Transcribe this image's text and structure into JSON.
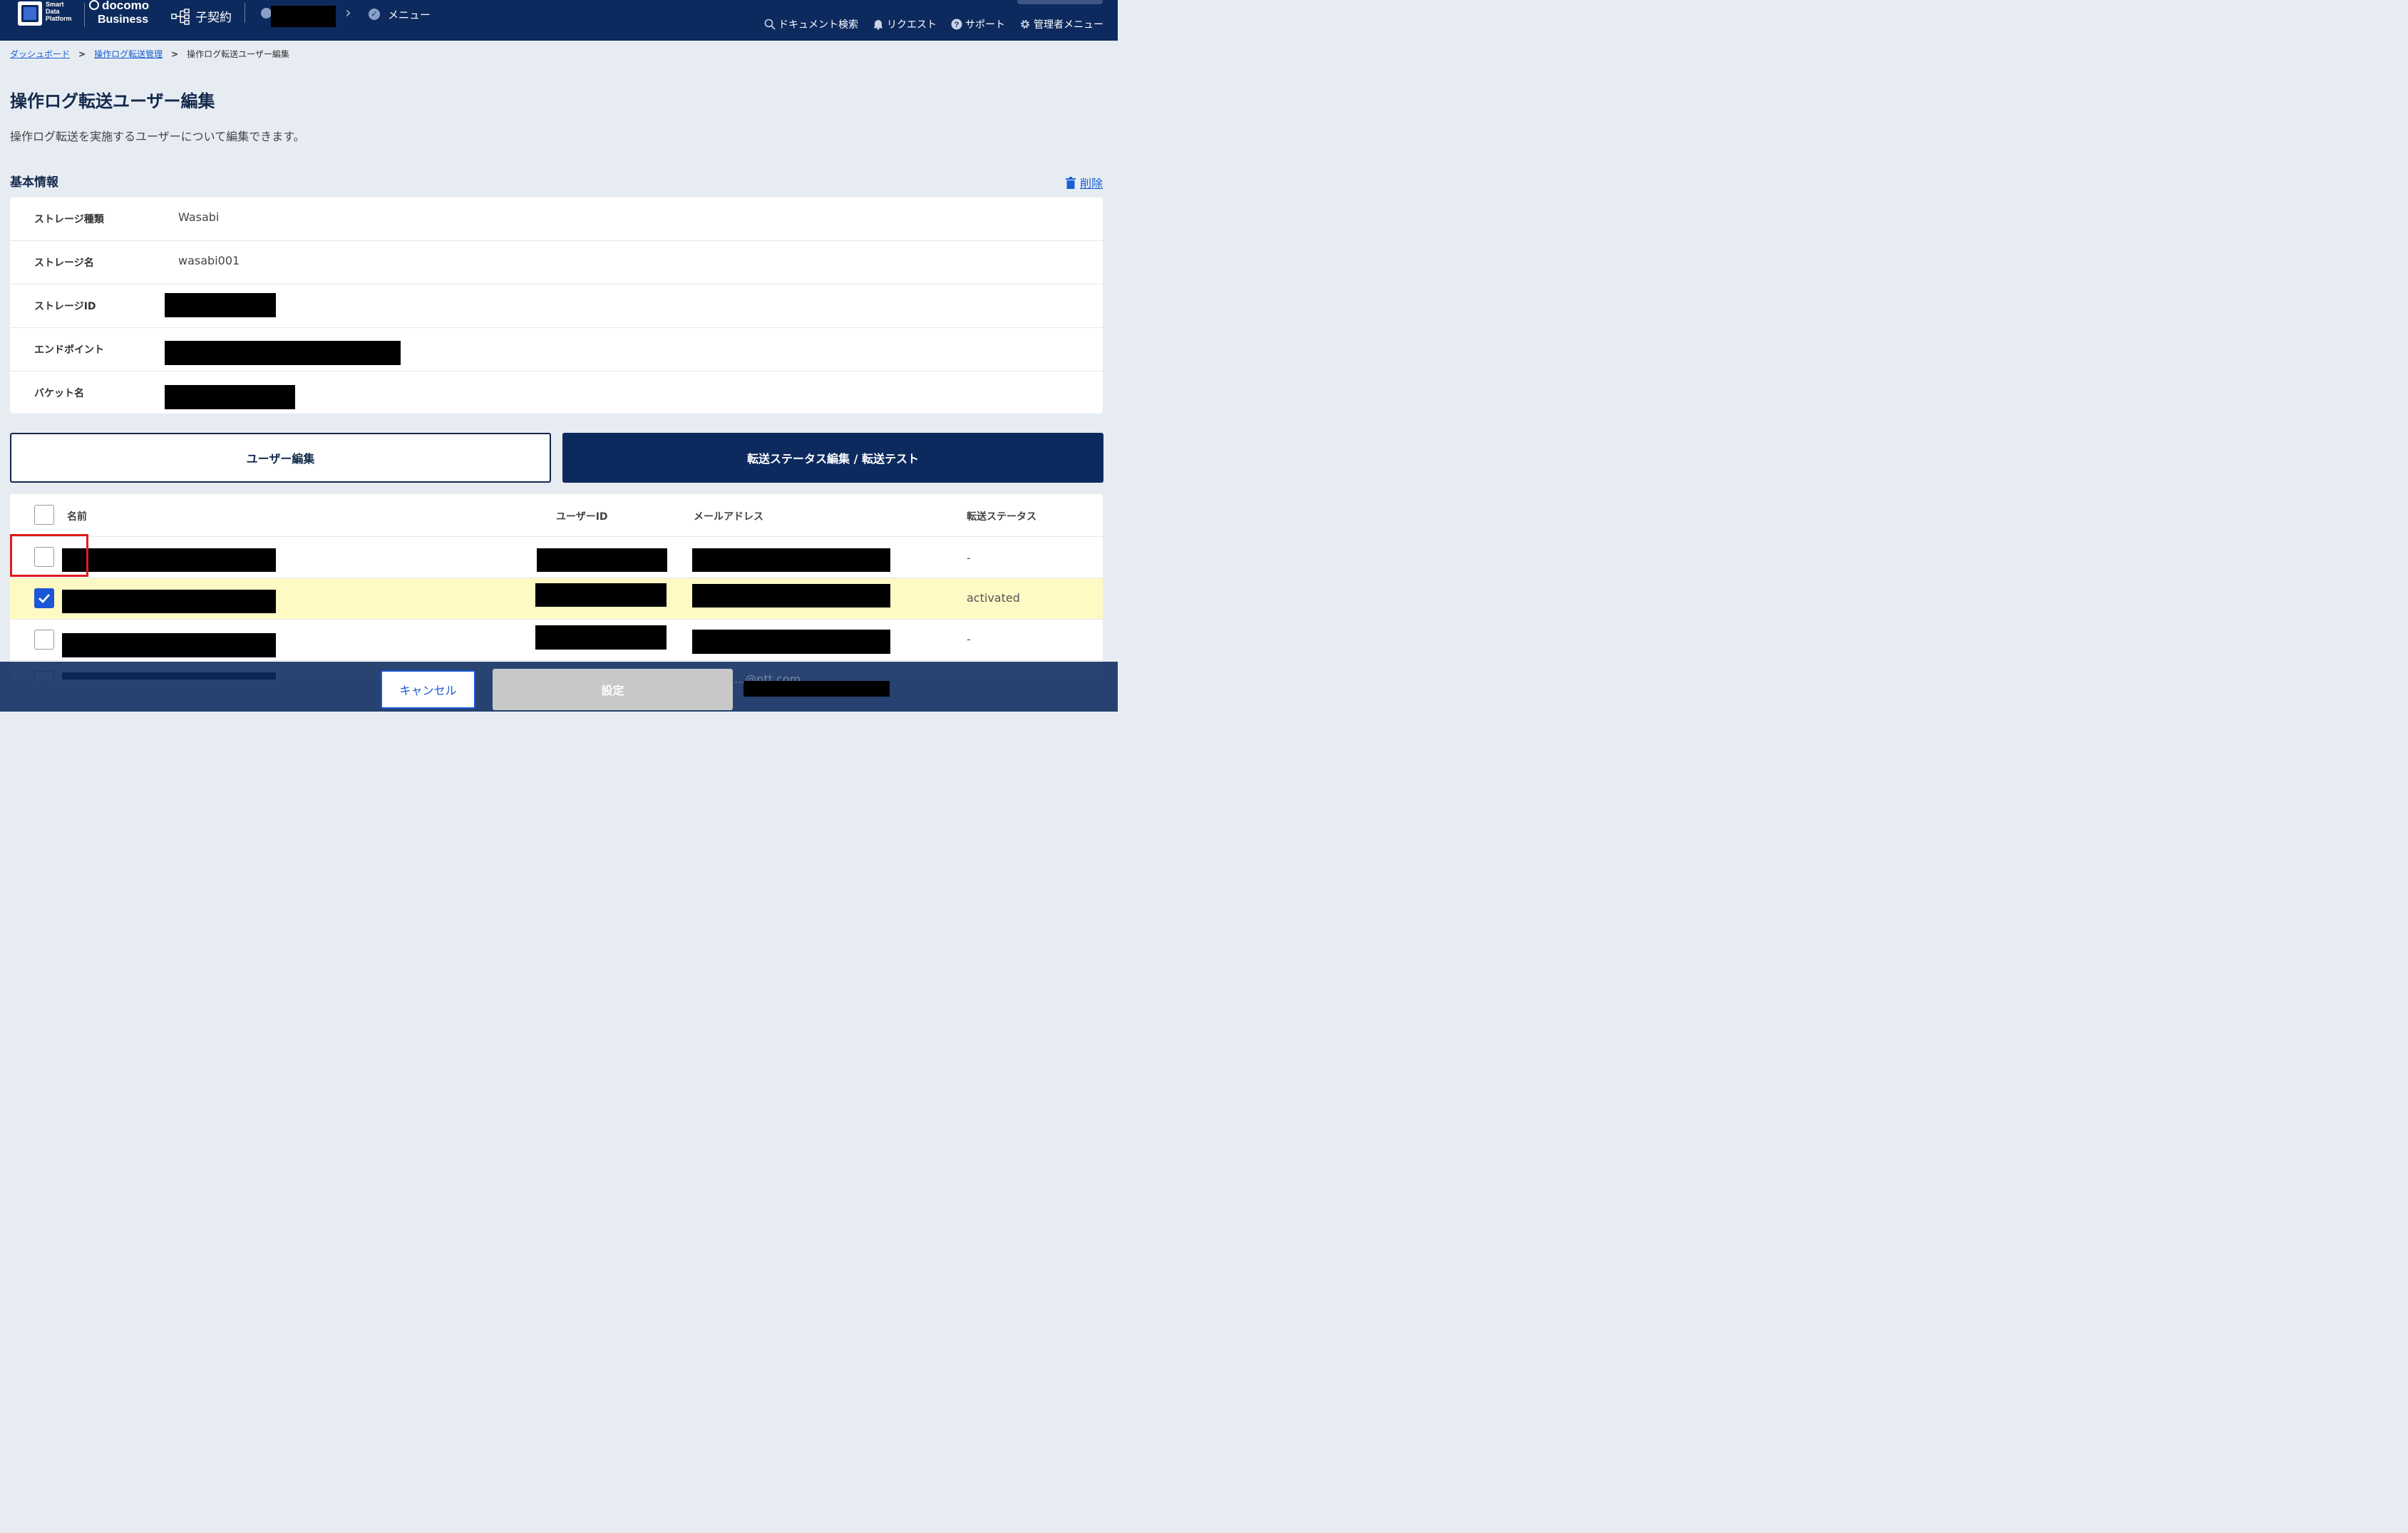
{
  "header": {
    "brand_sdp": [
      "Smart",
      "Data",
      "Platform"
    ],
    "brand_docomo": "docomo",
    "brand_business": "Business",
    "contract_label": "子契約",
    "menu_label": "メニュー",
    "links": [
      {
        "label": "ドキュメント検索",
        "icon": "search-icon"
      },
      {
        "label": "リクエスト",
        "icon": "bell-icon"
      },
      {
        "label": "サポート",
        "icon": "help-icon"
      },
      {
        "label": "管理者メニュー",
        "icon": "gear-icon"
      }
    ]
  },
  "breadcrumb": {
    "items": [
      "ダッシュボード",
      "操作ログ転送管理"
    ],
    "current": "操作ログ転送ユーザー編集"
  },
  "page": {
    "title": "操作ログ転送ユーザー編集",
    "description": "操作ログ転送を実施するユーザーについて編集できます。"
  },
  "basic_info": {
    "title": "基本情報",
    "delete_label": "削除",
    "rows": [
      {
        "label": "ストレージ種類",
        "value": "Wasabi"
      },
      {
        "label": "ストレージ名",
        "value": "wasabi001"
      },
      {
        "label": "ストレージID",
        "value": ""
      },
      {
        "label": "エンドポイント",
        "value": ""
      },
      {
        "label": "バケット名",
        "value": ""
      }
    ]
  },
  "tabs": {
    "user_edit": "ユーザー編集",
    "status_edit": "転送ステータス編集 / 転送テスト"
  },
  "table": {
    "headers": {
      "name": "名前",
      "user_id": "ユーザーID",
      "email": "メールアドレス",
      "status": "転送ステータス"
    },
    "rows": [
      {
        "checked": false,
        "status": "-"
      },
      {
        "checked": true,
        "status": "activated"
      },
      {
        "checked": false,
        "status": "-"
      },
      {
        "checked": false,
        "status": "-"
      }
    ]
  },
  "footer": {
    "cancel_label": "キャンセル",
    "set_label": "設定",
    "partial_email_text": "...@ntt.com"
  },
  "colors": {
    "header_bg": "#0d2a5e",
    "accent": "#1a56d6",
    "selected_row": "#fff9c4",
    "highlight": "#e01b1b"
  }
}
